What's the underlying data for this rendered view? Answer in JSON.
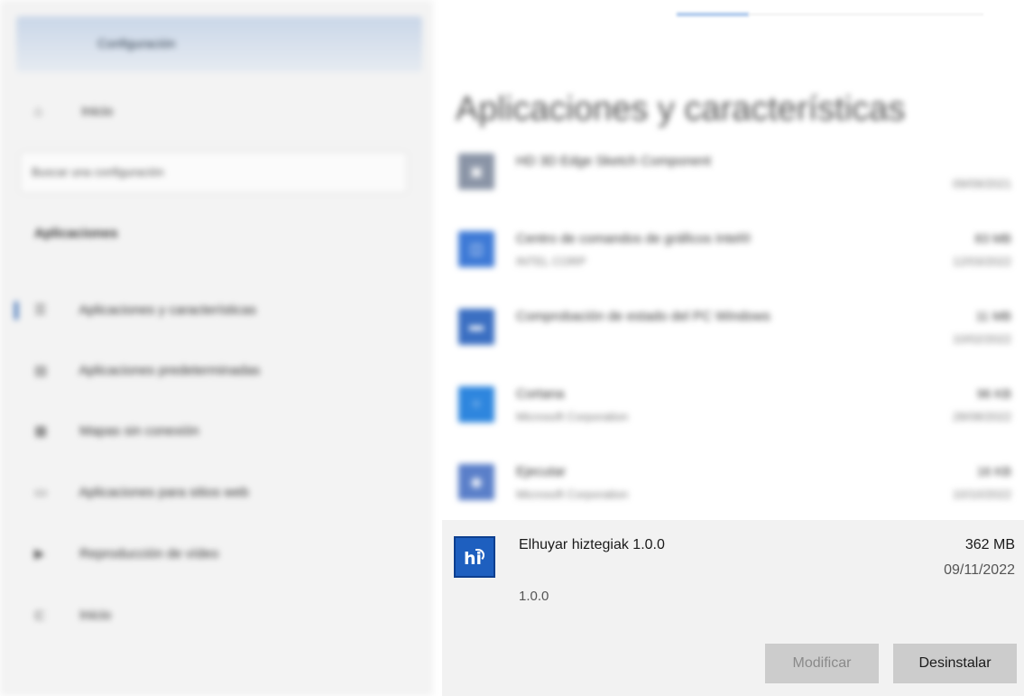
{
  "sidebar": {
    "window_title": "Configuración",
    "home_label": "Inicio",
    "search_placeholder": "Buscar una configuración",
    "section_title": "Aplicaciones",
    "items": [
      {
        "label": "Aplicaciones y características",
        "icon": "apps-list-icon",
        "active": true
      },
      {
        "label": "Aplicaciones predeterminadas",
        "icon": "default-apps-icon"
      },
      {
        "label": "Mapas sin conexión",
        "icon": "offline-maps-icon"
      },
      {
        "label": "Aplicaciones para sitios web",
        "icon": "websites-apps-icon"
      },
      {
        "label": "Reproducción de vídeo",
        "icon": "video-playback-icon"
      },
      {
        "label": "Inicio",
        "icon": "startup-icon"
      }
    ]
  },
  "main": {
    "title": "Aplicaciones y características",
    "apps": [
      {
        "name": "HD 3D Edge Sketch Component",
        "publisher": "",
        "size": "",
        "date": "09/09/2021",
        "icon_color": "#8a94a6"
      },
      {
        "name": "Centro de comandos de gráficos Intel®",
        "publisher": "INTEL CORP",
        "size": "83 MB",
        "date": "12/03/2022",
        "icon_color": "#3e7ad6"
      },
      {
        "name": "Comprobación de estado del PC Windows",
        "publisher": "",
        "size": "11 MB",
        "date": "10/02/2022",
        "icon_color": "#3b6fc2"
      },
      {
        "name": "Cortana",
        "publisher": "Microsoft Corporation",
        "size": "96 KB",
        "date": "28/08/2022",
        "icon_color": "#2e86de"
      },
      {
        "name": "Ejecutar",
        "publisher": "Microsoft Corporation",
        "size": "16 KB",
        "date": "10/10/2022",
        "icon_color": "#5a7fc9"
      }
    ],
    "selected_app": {
      "name": "Elhuyar hiztegiak 1.0.0",
      "size": "362 MB",
      "date": "09/11/2022",
      "version": "1.0.0",
      "icon_text": "hi",
      "icon_color": "#1e5fbf",
      "modify_label": "Modificar",
      "uninstall_label": "Desinstalar"
    }
  }
}
